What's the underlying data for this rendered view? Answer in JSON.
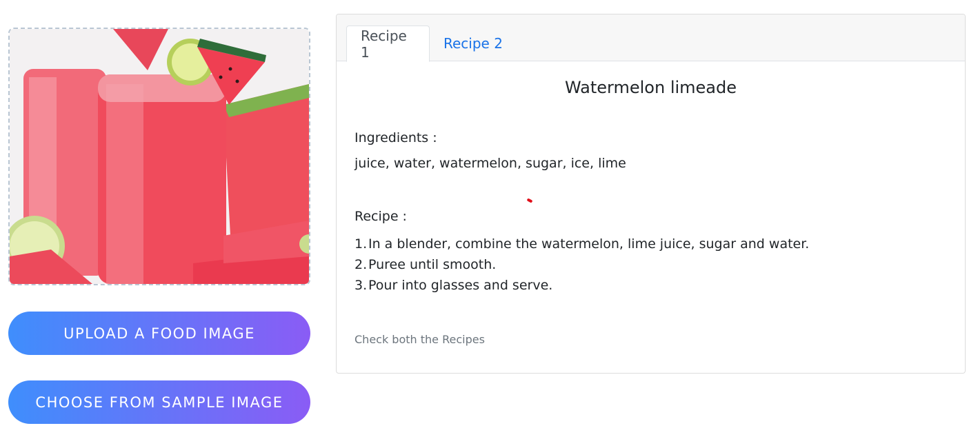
{
  "left_panel": {
    "image_alt": "Watermelon limeade drink",
    "upload_button": "UPLOAD A FOOD IMAGE",
    "sample_button": "CHOOSE FROM SAMPLE IMAGE"
  },
  "card": {
    "tabs": [
      {
        "label": "Recipe 1",
        "active": true
      },
      {
        "label": "Recipe 2",
        "active": false
      }
    ],
    "title": "Watermelon limeade",
    "ingredients_label": "Ingredients :",
    "ingredients": "juice, water, watermelon, sugar, ice, lime",
    "recipe_label": "Recipe :",
    "steps": [
      {
        "num": "1.",
        "text": "In a blender, combine the watermelon, lime juice, sugar and water."
      },
      {
        "num": "2.",
        "text": "Puree until smooth."
      },
      {
        "num": "3.",
        "text": "Pour into glasses and serve."
      }
    ],
    "footnote": "Check both the Recipes"
  },
  "colors": {
    "button_gradient_start": "#3f8efc",
    "button_gradient_end": "#8a5cf5",
    "tab_link": "#1a73e8"
  }
}
